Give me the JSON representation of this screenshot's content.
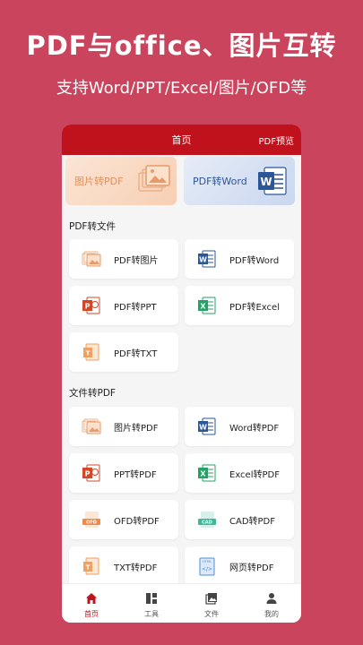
{
  "promo": {
    "title": "PDF与office、图片互转",
    "subtitle": "支持Word/PPT/Excel/图片/OFD等"
  },
  "header": {
    "title": "首页",
    "right_link": "PDF预览"
  },
  "banners": {
    "left_label": "图片转PDF",
    "right_label": "PDF转Word"
  },
  "sections": {
    "pdf_to_file": {
      "title": "PDF转文件",
      "items": [
        {
          "label": "PDF转图片",
          "icon": "image-icon"
        },
        {
          "label": "PDF转Word",
          "icon": "word-icon"
        },
        {
          "label": "PDF转PPT",
          "icon": "ppt-icon"
        },
        {
          "label": "PDF转Excel",
          "icon": "excel-icon"
        },
        {
          "label": "PDF转TXT",
          "icon": "txt-icon"
        }
      ]
    },
    "file_to_pdf": {
      "title": "文件转PDF",
      "items": [
        {
          "label": "图片转PDF",
          "icon": "image-icon"
        },
        {
          "label": "Word转PDF",
          "icon": "word-icon"
        },
        {
          "label": "PPT转PDF",
          "icon": "ppt-icon"
        },
        {
          "label": "Excel转PDF",
          "icon": "excel-icon"
        },
        {
          "label": "OFD转PDF",
          "icon": "ofd-icon"
        },
        {
          "label": "CAD转PDF",
          "icon": "cad-icon"
        },
        {
          "label": "TXT转PDF",
          "icon": "txt-icon"
        },
        {
          "label": "网页转PDF",
          "icon": "html-icon"
        }
      ]
    }
  },
  "icon_text": {
    "ofd": "OFD",
    "cad": "CAD",
    "html": "HTML"
  },
  "tabbar": [
    {
      "label": "首页",
      "icon": "home-icon",
      "active": true
    },
    {
      "label": "工具",
      "icon": "tools-icon",
      "active": false
    },
    {
      "label": "文件",
      "icon": "files-icon",
      "active": false
    },
    {
      "label": "我的",
      "icon": "profile-icon",
      "active": false
    }
  ],
  "colors": {
    "background": "#c9445c",
    "header": "#c0121c",
    "word": "#2b579a",
    "ppt": "#d24726",
    "excel": "#21a366",
    "orange": "#f0a060",
    "ofd": "#f08a4b",
    "cad": "#3cb89a",
    "html": "#4a90d9"
  }
}
